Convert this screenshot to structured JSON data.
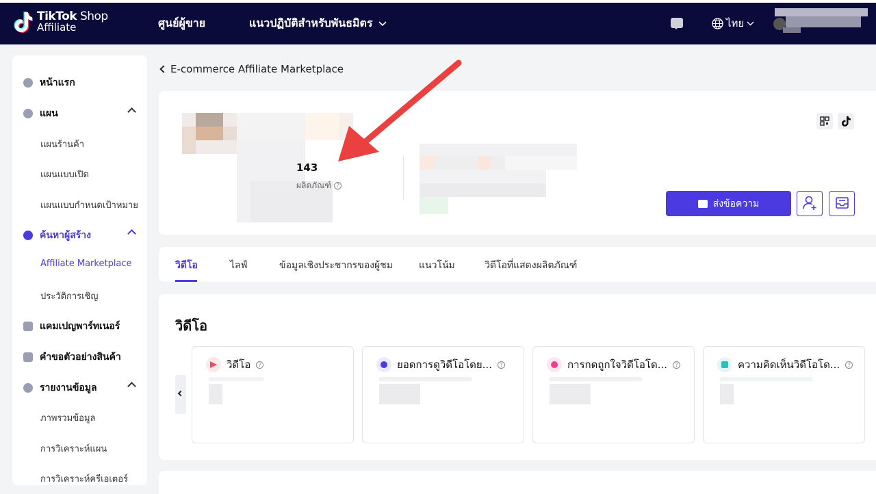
{
  "header": {
    "logo_line1_bold": "TikTok",
    "logo_line1_rest": " Shop",
    "logo_line2": "Affiliate",
    "nav": [
      {
        "label": "ศูนย์ผู้ขาย"
      },
      {
        "label": "แนวปฏิบัติสำหรับพันธมิตร"
      }
    ],
    "language": "ไทย"
  },
  "sidebar": {
    "items": [
      {
        "label": "หน้าแรก"
      },
      {
        "label": "แผน"
      },
      {
        "label": "แผนร้านค้า"
      },
      {
        "label": "แผนแบบเปิด"
      },
      {
        "label": "แผนแบบกำหนดเป้าหมาย"
      },
      {
        "label": "ค้นหาผู้สร้าง"
      },
      {
        "label": "Affiliate Marketplace"
      },
      {
        "label": "ประวัติการเชิญ"
      },
      {
        "label": "แคมเปญพาร์ทเนอร์"
      },
      {
        "label": "คำขอตัวอย่างสินค้า"
      },
      {
        "label": "รายงานข้อมูล"
      },
      {
        "label": "ภาพรวมข้อมูล"
      },
      {
        "label": "การวิเคราะห์แผน"
      },
      {
        "label": "การวิเคราะห์ครีเอเตอร์"
      }
    ]
  },
  "breadcrumb": "E-commerce Affiliate Marketplace",
  "profile": {
    "products_count": "143",
    "products_label": "ผลิตภัณฑ์",
    "send_message_label": "ส่งข้อความ"
  },
  "tabs": [
    {
      "label": "วิดีโอ"
    },
    {
      "label": "ไลฟ์"
    },
    {
      "label": "ข้อมูลเชิงประชากรของผู้ชม"
    },
    {
      "label": "แนวโน้ม"
    },
    {
      "label": "วิดีโอที่แสดงผลิตภัณฑ์"
    }
  ],
  "video_section": {
    "title": "วิดีโอ",
    "metrics": [
      {
        "label": "วิดีโอ"
      },
      {
        "label": "ยอดการดูวิดีโอโดย..."
      },
      {
        "label": "การกดถูกใจวิดีโอโด..."
      },
      {
        "label": "ความคิดเห็นวิดีโอโด..."
      }
    ]
  },
  "colors": {
    "accent": "#4a3ae0",
    "header_bg": "#0b0b3b",
    "annotation_arrow": "#ea4040"
  }
}
